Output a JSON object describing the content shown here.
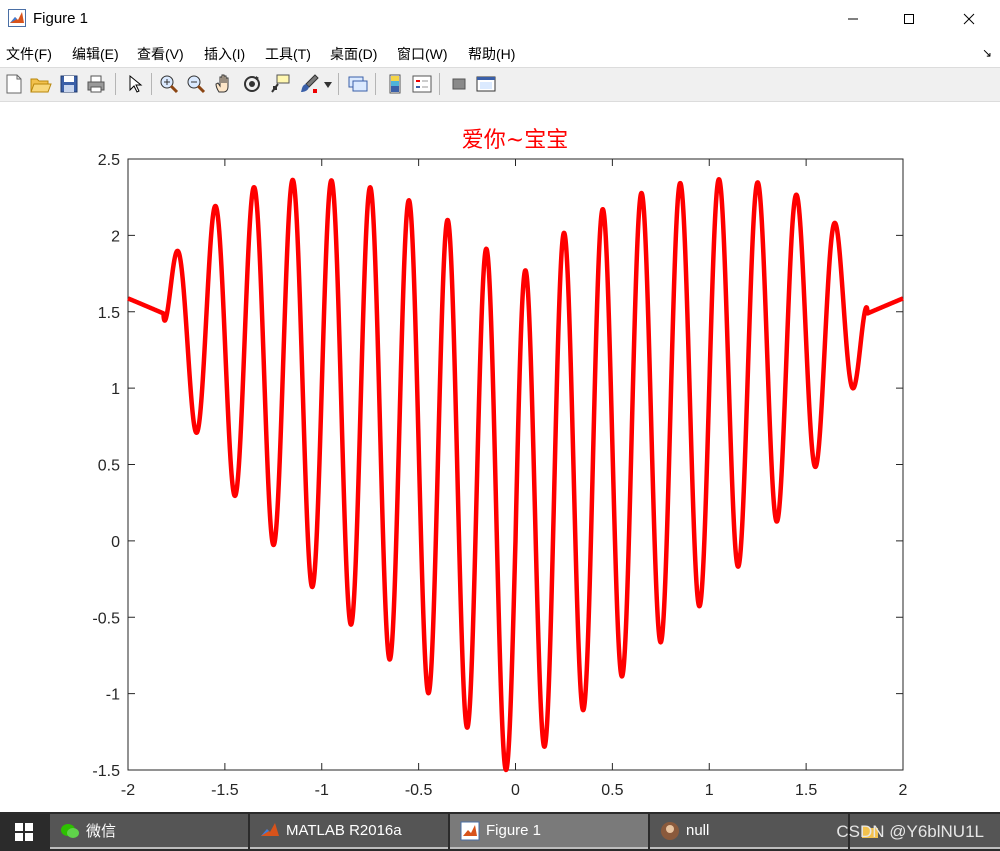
{
  "window": {
    "title": "Figure 1"
  },
  "menu": [
    "文件(F)",
    "编辑(E)",
    "查看(V)",
    "插入(I)",
    "工具(T)",
    "桌面(D)",
    "窗口(W)",
    "帮助(H)"
  ],
  "toolbar_icons": [
    "new-figure-icon",
    "open-file-icon",
    "save-icon",
    "print-icon",
    "pointer-icon",
    "zoom-in-icon",
    "zoom-out-icon",
    "pan-hand-icon",
    "rotate-3d-icon",
    "data-cursor-icon",
    "brush-icon",
    "link-plot-icon",
    "colorbar-icon",
    "legend-icon",
    "hide-plot-tools-icon",
    "show-plot-tools-icon"
  ],
  "chart_data": {
    "type": "line",
    "title": "爱你~宝宝",
    "title_color": "#ff0000",
    "line_color": "#ff0000",
    "xlabel": "",
    "ylabel": "",
    "xlim": [
      -2,
      2
    ],
    "ylim": [
      -1.5,
      2.5
    ],
    "xticks": [
      "-2",
      "-1.5",
      "-1",
      "-0.5",
      "0",
      "0.5",
      "1",
      "1.5",
      "2"
    ],
    "yticks": [
      "2.5",
      "2",
      "1.5",
      "1",
      "0.5",
      "0",
      "-0.5",
      "-1",
      "-1.5"
    ],
    "grid": false,
    "function": "y = |x|^(2/3) + 0.9*sqrt(3.3 - x^2)*sin(10*pi*x) (real part; outside |x|>sqrt(3.3) the sin term is imaginary and dropped)",
    "series": [
      {
        "x_range": [
          -2,
          2
        ]
      }
    ]
  },
  "taskbar": {
    "items": [
      {
        "label": "微信",
        "icon": "wechat-icon"
      },
      {
        "label": "MATLAB R2016a",
        "icon": "matlab-icon"
      },
      {
        "label": "Figure 1",
        "icon": "matlab-figure-icon"
      },
      {
        "label": "null",
        "icon": "avatar-icon"
      }
    ],
    "watermark": "CSDN @Y6blNU1L"
  }
}
